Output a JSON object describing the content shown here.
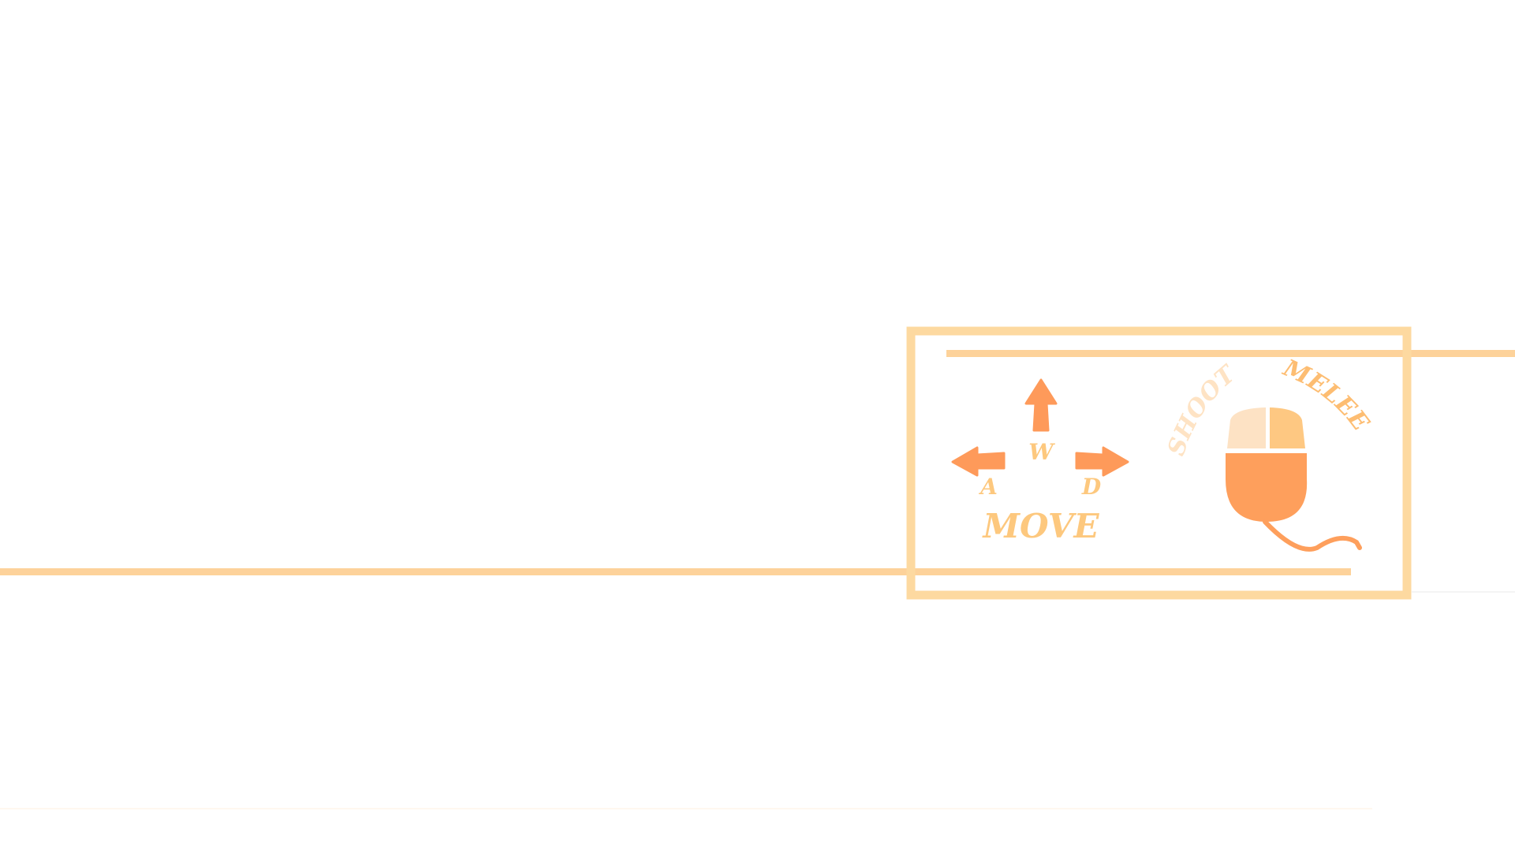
{
  "controls": {
    "move": {
      "up_key": "W",
      "left_key": "A",
      "right_key": "D",
      "label": "MOVE"
    },
    "mouse": {
      "left_label": "SHOOT",
      "right_label": "MELEE"
    }
  },
  "colors": {
    "frame": "#fdd9a0",
    "line": "#fdd29a",
    "arrow": "#fe9a5a",
    "text": "#fdc87e",
    "mouse_body": "#fe9f5c",
    "mouse_left_button": "#fde2c4",
    "mouse_right_button": "#fec882",
    "shoot_text": "#fee3c4",
    "melee_text": "#fdbd72"
  },
  "icons": {
    "up": "arrow-up-icon",
    "left": "arrow-left-icon",
    "right": "arrow-right-icon",
    "mouse": "mouse-icon"
  }
}
